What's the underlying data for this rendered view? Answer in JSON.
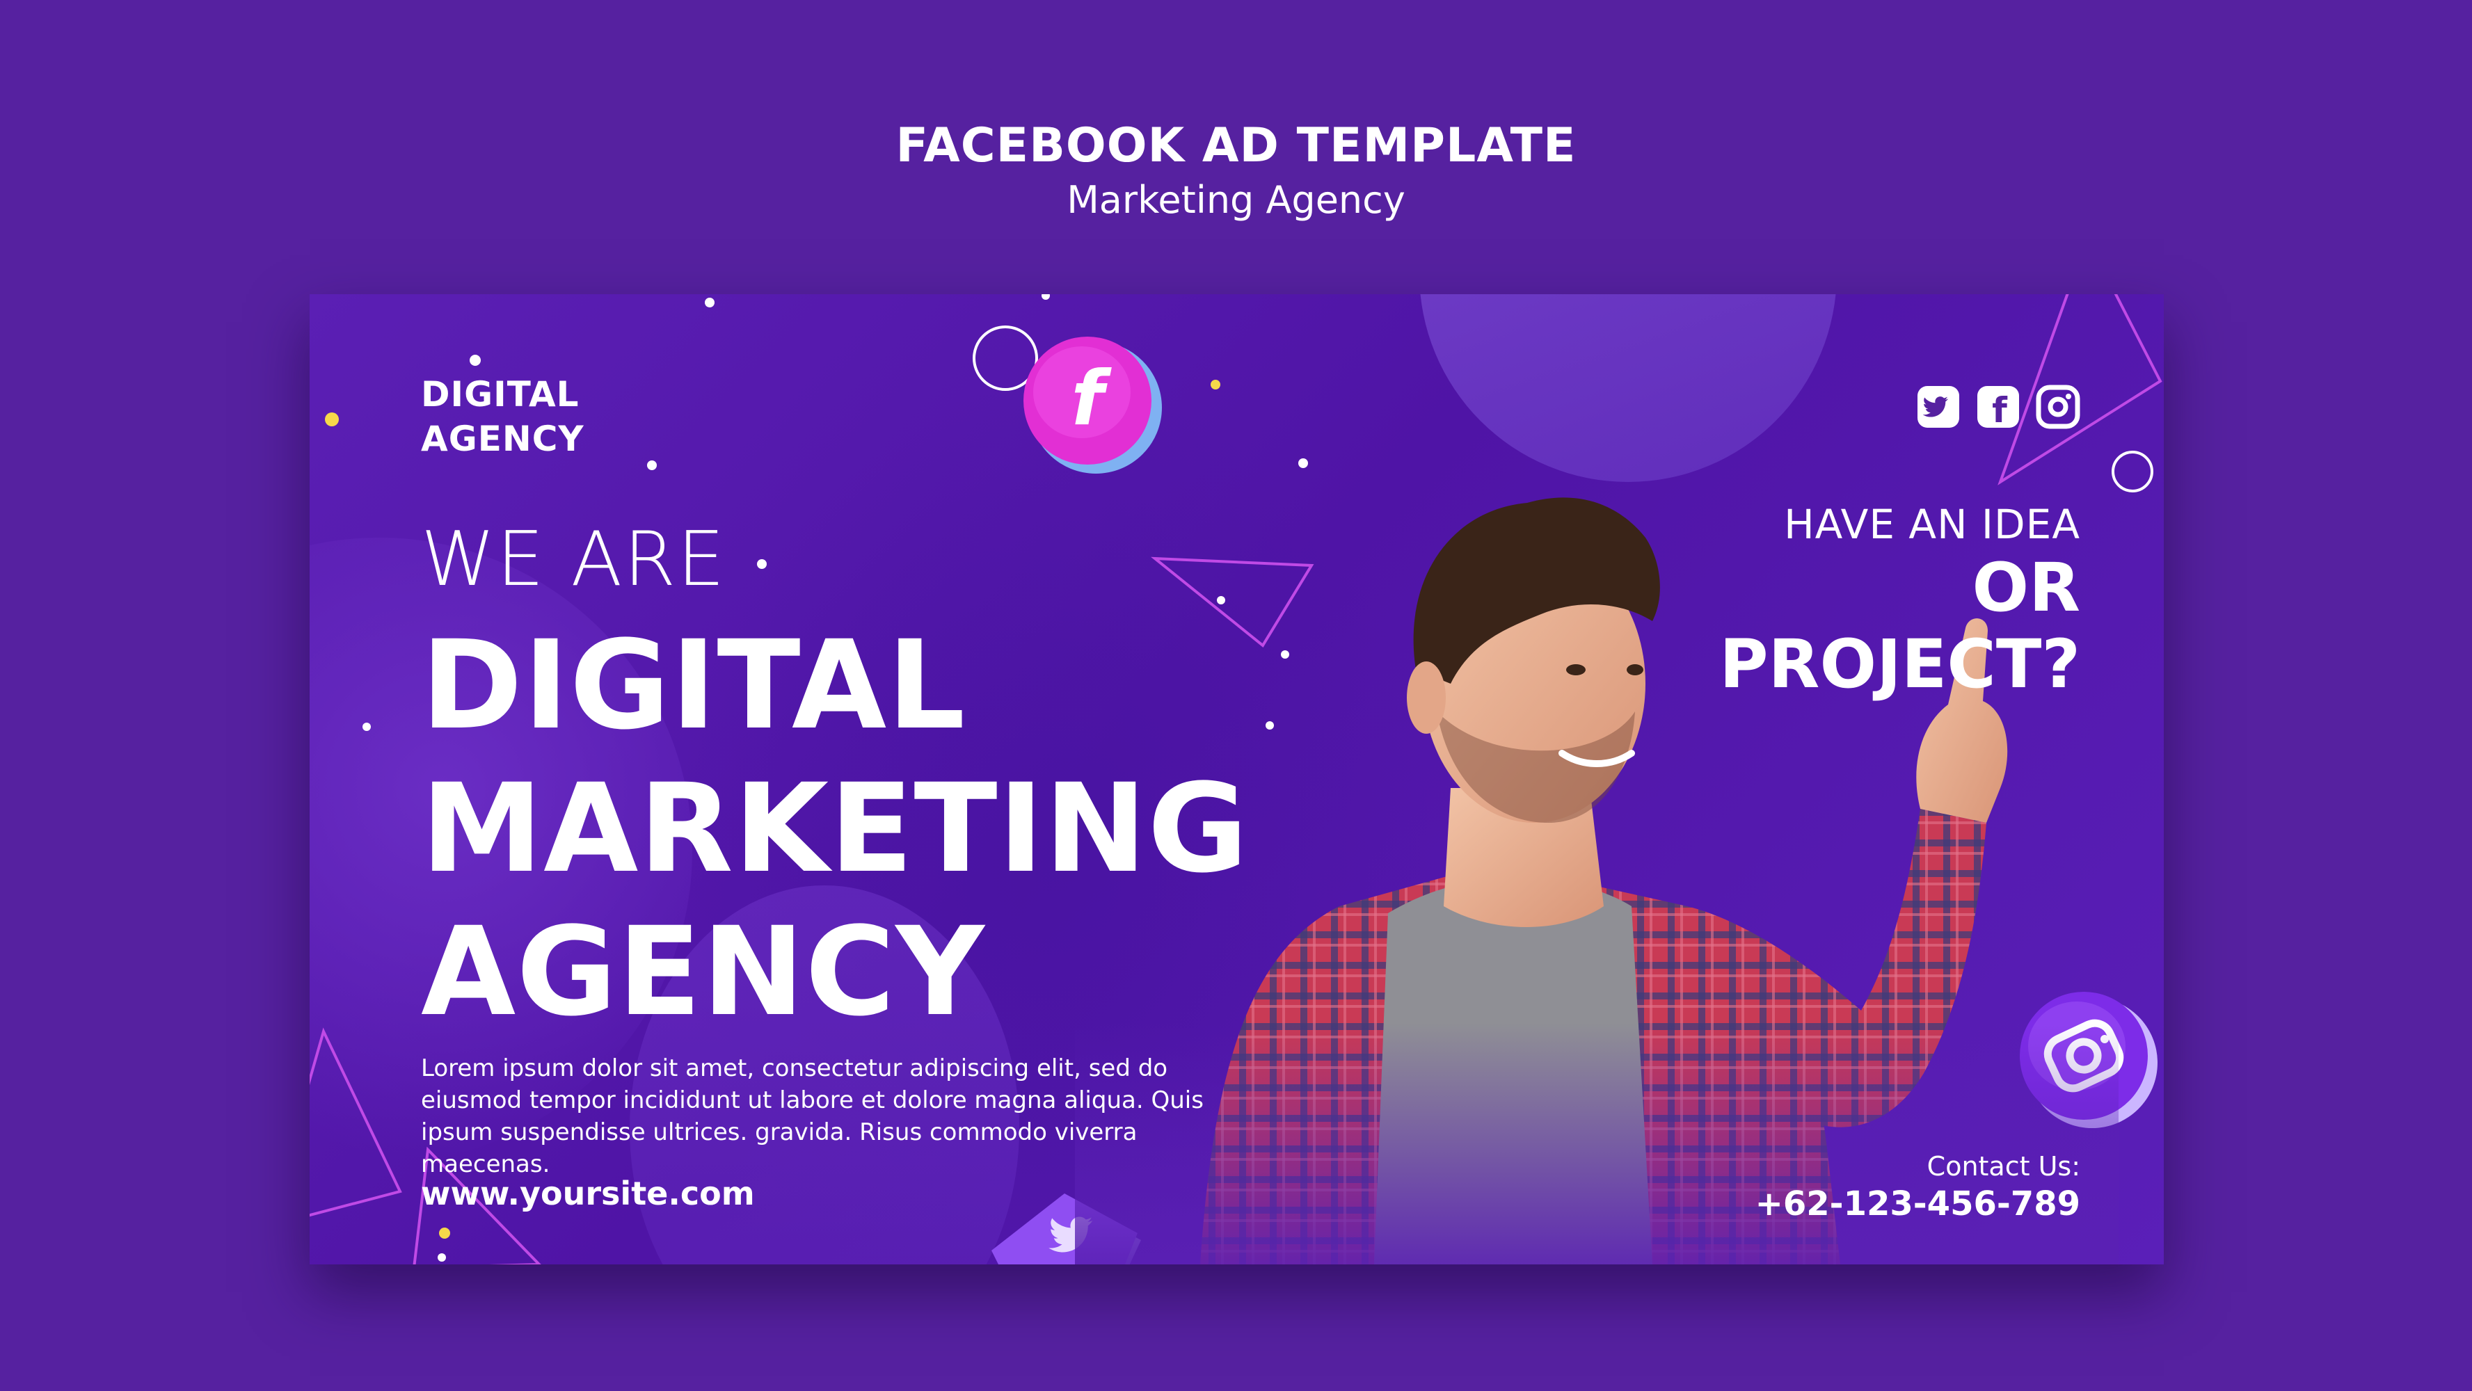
{
  "header": {
    "title": "FACEBOOK AD TEMPLATE",
    "subtitle": "Marketing Agency"
  },
  "ad": {
    "brand": [
      "DIGITAL",
      "AGENCY"
    ],
    "intro": "WE ARE",
    "headline": [
      "DIGITAL",
      "MARKETING",
      "AGENCY"
    ],
    "body": "Lorem ipsum dolor sit amet, consectetur adipiscing elit, sed do eiusmod tempor incididunt ut labore et dolore magna aliqua. Quis ipsum suspendisse ultrices. gravida. Risus commodo viverra maecenas.",
    "website": "www.yoursite.com",
    "question": [
      "HAVE AN IDEA",
      "OR",
      "PROJECT?"
    ],
    "contact_label": "Contact Us:",
    "contact_phone": "+62-123-456-789",
    "social_icons": [
      "twitter-icon",
      "facebook-icon",
      "instagram-icon"
    ],
    "floating_badges": [
      "facebook-badge",
      "instagram-badge",
      "twitter-badge"
    ]
  },
  "colors": {
    "background": "#5621a0",
    "card": "#5b1fb4",
    "accent_pink": "#e52cd6",
    "accent_purple": "#8a3df0",
    "text": "#ffffff"
  }
}
